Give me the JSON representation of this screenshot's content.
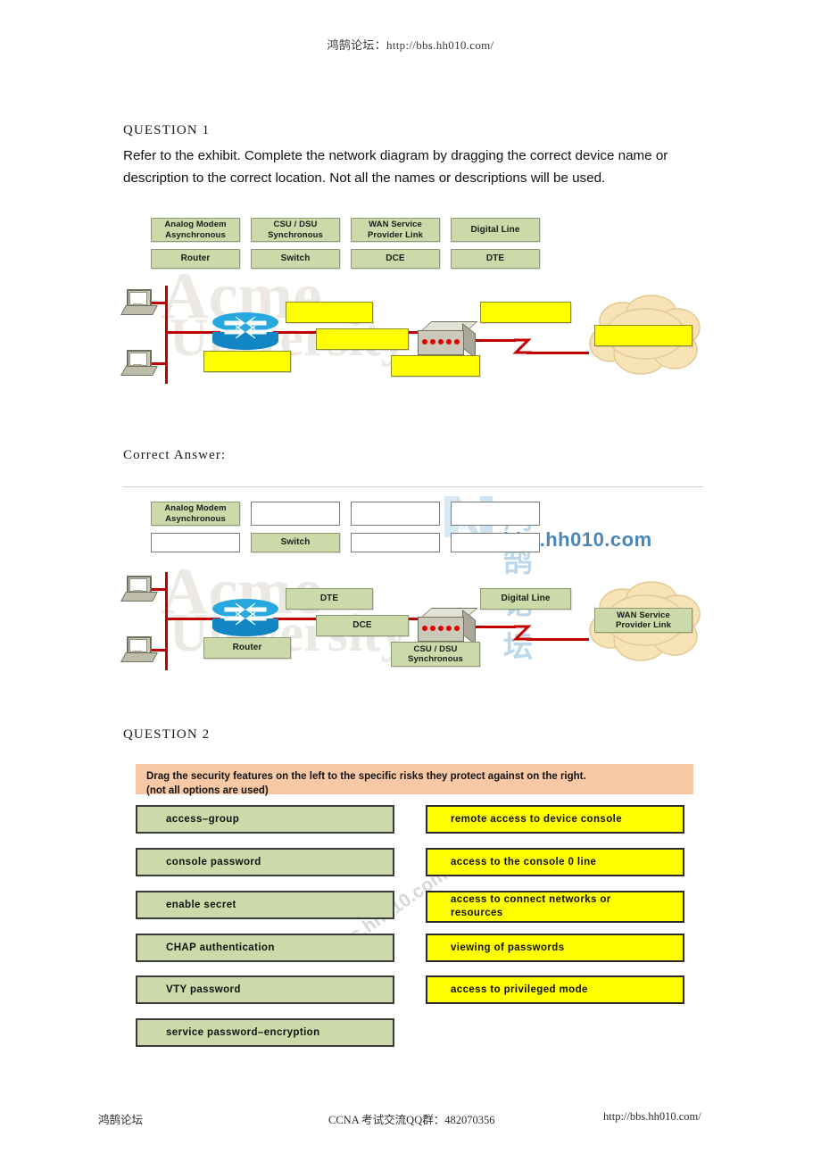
{
  "header": {
    "watermark_text": "鸿鹄论坛：http://bbs.hh010.com/"
  },
  "footer": {
    "left": "鸿鹄论坛",
    "middle": "CCNA 考试交流QQ群：482070356",
    "right": "http://bbs.hh010.com/"
  },
  "watermarks": {
    "acme_top": "Acme",
    "acme_bottom": "University",
    "forum_cn": "鸿鹄论坛",
    "forum_en": "bbs.hh010.com",
    "bbs_diagonal": "bbs.hh010.com"
  },
  "question1": {
    "label": "QUESTION 1",
    "text": "Refer to the exhibit. Complete the network diagram by dragging the correct device name or description to the correct location. Not all the names or descriptions will be used.",
    "answer_label": "Correct Answer:",
    "options": [
      {
        "id": "analog-modem",
        "label": "Analog Modem Asynchronous",
        "lines": [
          "Analog Modem",
          "Asynchronous"
        ]
      },
      {
        "id": "csu-dsu",
        "label": "CSU / DSU Synchronous",
        "lines": [
          "CSU / DSU",
          "Synchronous"
        ]
      },
      {
        "id": "wan-link",
        "label": "WAN Service Provider Link",
        "lines": [
          "WAN Service",
          "Provider Link"
        ]
      },
      {
        "id": "digital-line",
        "label": "Digital Line",
        "lines": [
          "Digital Line"
        ]
      },
      {
        "id": "router",
        "label": "Router",
        "lines": [
          "Router"
        ]
      },
      {
        "id": "switch",
        "label": "Switch",
        "lines": [
          "Switch"
        ]
      },
      {
        "id": "dce",
        "label": "DCE",
        "lines": [
          "DCE"
        ]
      },
      {
        "id": "dte",
        "label": "DTE",
        "lines": [
          "DTE"
        ]
      }
    ],
    "exhibit_drop_targets": [
      {
        "id": "drop-top-left",
        "value": ""
      },
      {
        "id": "drop-mid",
        "value": ""
      },
      {
        "id": "drop-bottom-left",
        "value": ""
      },
      {
        "id": "drop-bottom-mid",
        "value": ""
      },
      {
        "id": "drop-right",
        "value": ""
      },
      {
        "id": "drop-cloud",
        "value": ""
      }
    ],
    "answer_option_slots": [
      {
        "id": "slot-1",
        "used": false,
        "lines": [
          "Analog Modem",
          "Asynchronous"
        ]
      },
      {
        "id": "slot-2",
        "used": true,
        "lines": []
      },
      {
        "id": "slot-3",
        "used": true,
        "lines": []
      },
      {
        "id": "slot-4",
        "used": true,
        "lines": []
      },
      {
        "id": "slot-5",
        "used": true,
        "lines": []
      },
      {
        "id": "slot-6",
        "used": false,
        "lines": [
          "Switch"
        ]
      },
      {
        "id": "slot-7",
        "used": true,
        "lines": []
      },
      {
        "id": "slot-8",
        "used": true,
        "lines": []
      }
    ],
    "answer_placements": [
      {
        "id": "ans-top-left",
        "lines": [
          "DTE"
        ]
      },
      {
        "id": "ans-mid",
        "lines": [
          "DCE"
        ]
      },
      {
        "id": "ans-bottom-left",
        "lines": [
          "Router"
        ]
      },
      {
        "id": "ans-bottom-mid",
        "lines": [
          "CSU / DSU",
          "Synchronous"
        ]
      },
      {
        "id": "ans-right",
        "lines": [
          "Digital Line"
        ]
      },
      {
        "id": "ans-cloud",
        "lines": [
          "WAN Service",
          "Provider Link"
        ]
      }
    ]
  },
  "question2": {
    "label": "QUESTION 2",
    "instruction_line1": "Drag the security features on the left to the specific risks they protect against on the right.",
    "instruction_line2": "(not all options are used)",
    "left_items": [
      "access–group",
      "console password",
      "enable secret",
      "CHAP authentication",
      "VTY password",
      "service password–encryption"
    ],
    "right_items": [
      {
        "lines": [
          "remote access to device console"
        ]
      },
      {
        "lines": [
          "access to the console 0 line"
        ]
      },
      {
        "lines": [
          "access to connect networks or",
          "resources"
        ]
      },
      {
        "lines": [
          "viewing of passwords"
        ]
      },
      {
        "lines": [
          "access to privileged mode"
        ]
      }
    ]
  },
  "colors": {
    "chip_green": "#ccd9a8",
    "chip_yellow": "#ffff00",
    "bar_orange": "#f8c9a4",
    "wire_red": "#c00000",
    "router_blue": "#27a9e0",
    "cloud_tan": "#f5e2b8"
  }
}
